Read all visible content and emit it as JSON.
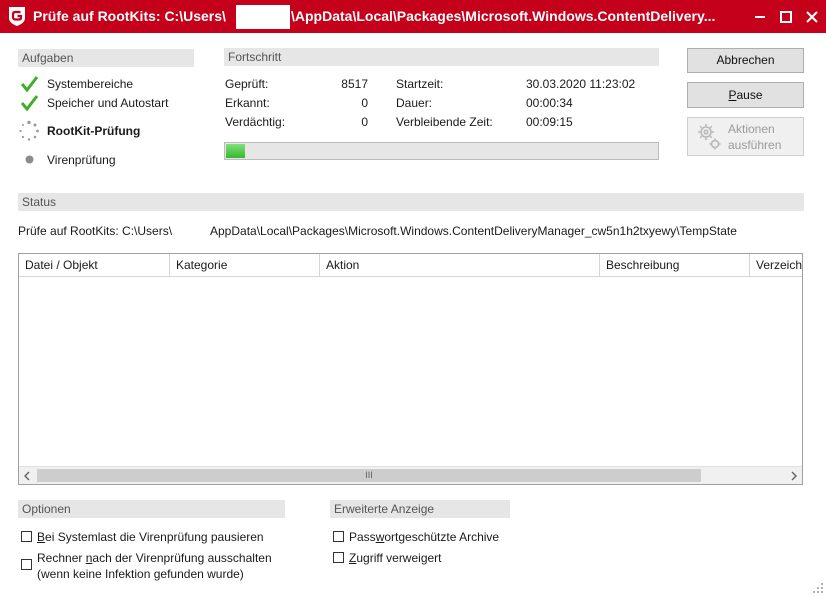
{
  "window": {
    "title_prefix": "Prüfe auf RootKits: C:\\Users\\",
    "title_suffix": "\\AppData\\Local\\Packages\\Microsoft.Windows.ContentDelivery...",
    "accent": "#c4001a"
  },
  "tasks": {
    "header": "Aufgaben",
    "items": [
      {
        "label": "Systembereiche",
        "state": "done"
      },
      {
        "label": "Speicher und Autostart",
        "state": "done"
      },
      {
        "label": "RootKit-Prüfung",
        "state": "running"
      },
      {
        "label": "Virenprüfung",
        "state": "pending"
      }
    ]
  },
  "progress": {
    "header": "Fortschritt",
    "checked_label": "Geprüft:",
    "checked_value": "8517",
    "detected_label": "Erkannt:",
    "detected_value": "0",
    "suspicious_label": "Verdächtig:",
    "suspicious_value": "0",
    "start_label": "Startzeit:",
    "start_value": "30.03.2020 11:23:02",
    "duration_label": "Dauer:",
    "duration_value": "00:00:34",
    "remaining_label": "Verbleibende Zeit:",
    "remaining_value": "00:09:15",
    "fraction": 0.045
  },
  "buttons": {
    "cancel": "Abbrechen",
    "pause": "Pause",
    "actions_line1": "Aktionen",
    "actions_line2": "ausführen"
  },
  "status": {
    "header": "Status",
    "text_prefix": "Prüfe auf RootKits: C:\\Users\\",
    "text_suffix": "AppData\\Local\\Packages\\Microsoft.Windows.ContentDeliveryManager_cw5n1h2txyewy\\TempState"
  },
  "table": {
    "columns": [
      "Datei / Objekt",
      "Kategorie",
      "Aktion",
      "Beschreibung",
      "Verzeichr"
    ],
    "rows": [],
    "scroll_grip": "III"
  },
  "options": {
    "header": "Optionen",
    "pause_on_load": {
      "label": "Bei Systemlast die Virenprüfung pausieren",
      "checked": false
    },
    "shutdown_line1": "Rechner nach der Virenprüfung ausschalten",
    "shutdown_line2": "(wenn keine Infektion gefunden wurde)",
    "shutdown_checked": false
  },
  "advanced": {
    "header": "Erweiterte Anzeige",
    "password_archives": {
      "label": "Passwortgeschützte Archive",
      "checked": false
    },
    "access_denied": {
      "label": "Zugriff verweigert",
      "checked": false
    }
  }
}
